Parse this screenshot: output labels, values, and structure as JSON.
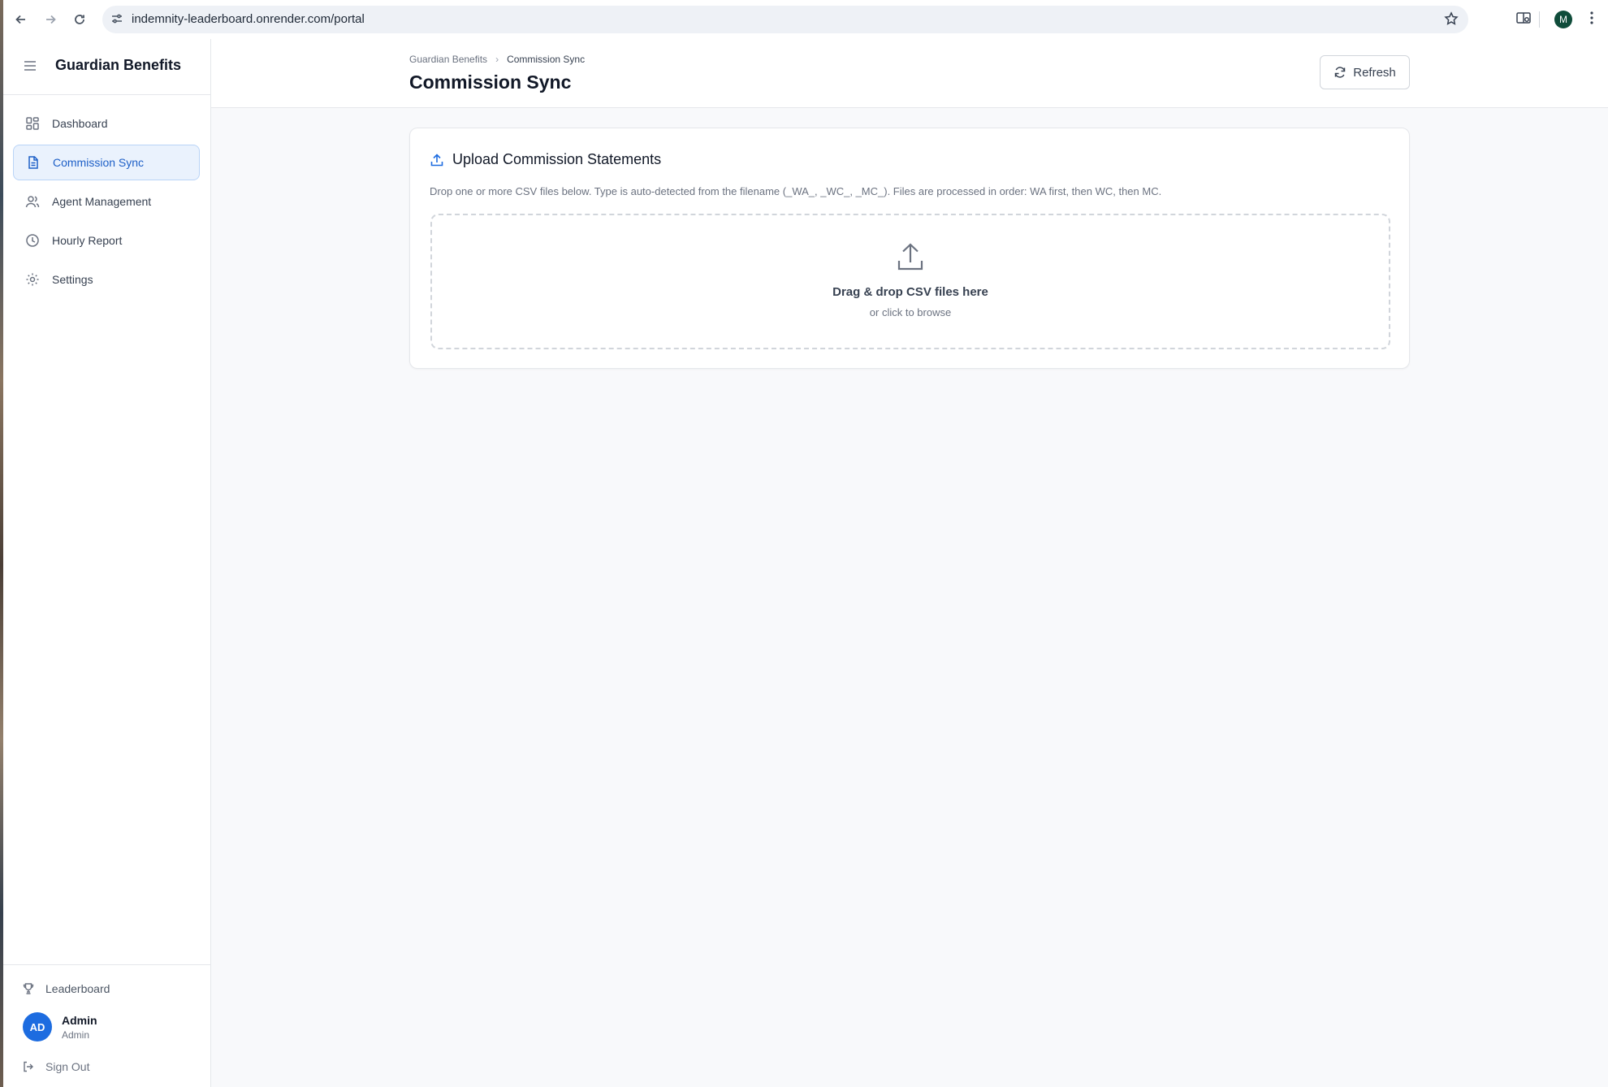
{
  "browser": {
    "url": "indemnity-leaderboard.onrender.com/portal",
    "profile_initial": "M"
  },
  "sidebar": {
    "brand": "Guardian Benefits",
    "items": [
      {
        "label": "Dashboard",
        "icon": "grid-icon"
      },
      {
        "label": "Commission Sync",
        "icon": "document-icon",
        "active": true
      },
      {
        "label": "Agent Management",
        "icon": "users-icon"
      },
      {
        "label": "Hourly Report",
        "icon": "clock-icon"
      },
      {
        "label": "Settings",
        "icon": "gear-icon"
      }
    ],
    "footer": {
      "leaderboard_label": "Leaderboard",
      "user_initials": "AD",
      "user_name": "Admin",
      "user_role": "Admin",
      "sign_out_label": "Sign Out"
    }
  },
  "header": {
    "breadcrumb": [
      "Guardian Benefits",
      "Commission Sync"
    ],
    "title": "Commission Sync",
    "refresh_label": "Refresh"
  },
  "upload_card": {
    "title": "Upload Commission Statements",
    "description": "Drop one or more CSV files below. Type is auto-detected from the filename (_WA_, _WC_, _MC_). Files are processed in order: WA first, then WC, then MC.",
    "dropzone_title": "Drag & drop CSV files here",
    "dropzone_subtitle": "or click to browse"
  },
  "colors": {
    "accent": "#1d6ce0",
    "active_bg": "#eaf2fd",
    "page_bg": "#f8f9fb"
  }
}
